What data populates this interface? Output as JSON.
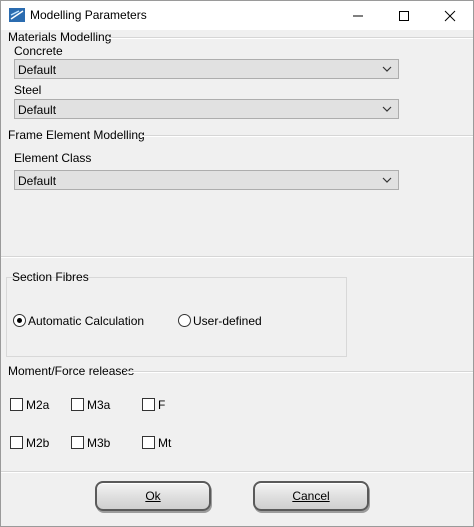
{
  "window": {
    "title": "Modelling Parameters"
  },
  "materials": {
    "heading": "Materials Modelling",
    "concrete_label": "Concrete",
    "concrete_value": "Default",
    "steel_label": "Steel",
    "steel_value": "Default"
  },
  "frame": {
    "heading": "Frame Element Modelling",
    "element_class_label": "Element Class",
    "element_class_value": "Default"
  },
  "section_fibres": {
    "heading": "Section Fibres",
    "option_auto": "Automatic Calculation",
    "option_user": "User-defined",
    "selected": "Automatic Calculation"
  },
  "releases": {
    "heading": "Moment/Force releases",
    "items": [
      "M2a",
      "M3a",
      "F",
      "M2b",
      "M3b",
      "Mt"
    ]
  },
  "buttons": {
    "ok": "Ok",
    "cancel": "Cancel"
  }
}
